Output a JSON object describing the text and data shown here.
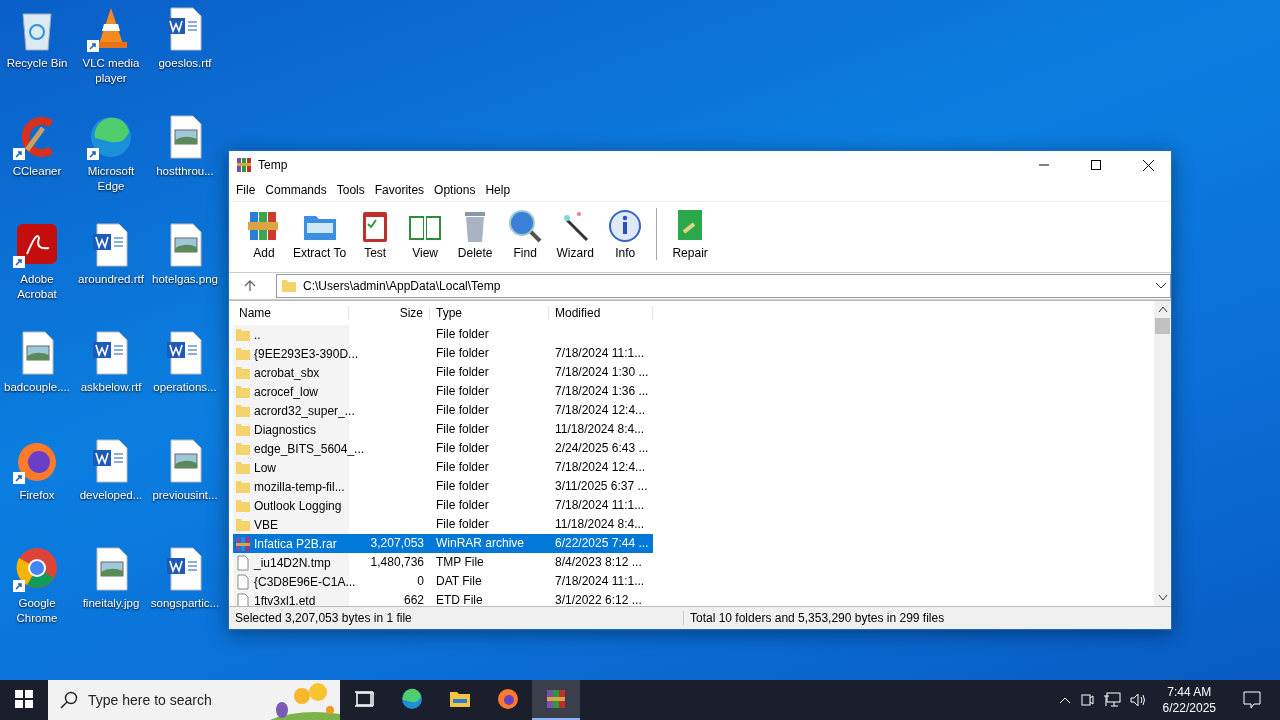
{
  "desktop_icons": [
    {
      "label": "Recycle Bin",
      "kind": "recycle",
      "shortcut": false
    },
    {
      "label": "VLC media player",
      "kind": "vlc",
      "shortcut": true
    },
    {
      "label": "goeslos.rtf",
      "kind": "word",
      "shortcut": false
    },
    {
      "label": "CCleaner",
      "kind": "ccleaner",
      "shortcut": true
    },
    {
      "label": "Microsoft Edge",
      "kind": "edge",
      "shortcut": true
    },
    {
      "label": "hostthrou...",
      "kind": "image",
      "shortcut": false
    },
    {
      "label": "Adobe Acrobat",
      "kind": "acrobat",
      "shortcut": true
    },
    {
      "label": "aroundred.rtf",
      "kind": "word",
      "shortcut": false
    },
    {
      "label": "hotelgas.png",
      "kind": "image",
      "shortcut": false
    },
    {
      "label": "badcouple....",
      "kind": "image",
      "shortcut": false
    },
    {
      "label": "askbelow.rtf",
      "kind": "word",
      "shortcut": false
    },
    {
      "label": "operations...",
      "kind": "word",
      "shortcut": false
    },
    {
      "label": "Firefox",
      "kind": "firefox",
      "shortcut": true
    },
    {
      "label": "developed...",
      "kind": "word",
      "shortcut": false
    },
    {
      "label": "previousint...",
      "kind": "image",
      "shortcut": false
    },
    {
      "label": "Google Chrome",
      "kind": "chrome",
      "shortcut": true
    },
    {
      "label": "fineitaly.jpg",
      "kind": "image",
      "shortcut": false
    },
    {
      "label": "songspartic...",
      "kind": "word",
      "shortcut": false
    }
  ],
  "window": {
    "title": "Temp",
    "menu": [
      "File",
      "Commands",
      "Tools",
      "Favorites",
      "Options",
      "Help"
    ],
    "toolbar": [
      {
        "label": "Add",
        "kind": "add"
      },
      {
        "label": "Extract To",
        "kind": "extract"
      },
      {
        "label": "Test",
        "kind": "test"
      },
      {
        "label": "View",
        "kind": "view"
      },
      {
        "label": "Delete",
        "kind": "delete"
      },
      {
        "label": "Find",
        "kind": "find"
      },
      {
        "label": "Wizard",
        "kind": "wizard"
      },
      {
        "label": "Info",
        "kind": "info"
      },
      {
        "label": "Repair",
        "kind": "repair"
      }
    ],
    "path": "C:\\Users\\admin\\AppData\\Local\\Temp",
    "columns": [
      "Name",
      "Size",
      "Type",
      "Modified"
    ],
    "rows": [
      {
        "name": "..",
        "size": "",
        "type": "File folder",
        "modified": "",
        "kind": "folder",
        "selected": false
      },
      {
        "name": "{9EE293E3-390D...",
        "size": "",
        "type": "File folder",
        "modified": "7/18/2024 11:1...",
        "kind": "folder",
        "selected": false
      },
      {
        "name": "acrobat_sbx",
        "size": "",
        "type": "File folder",
        "modified": "7/18/2024 1:30 ...",
        "kind": "folder",
        "selected": false
      },
      {
        "name": "acrocef_low",
        "size": "",
        "type": "File folder",
        "modified": "7/18/2024 1:36 ...",
        "kind": "folder",
        "selected": false
      },
      {
        "name": "acrord32_super_...",
        "size": "",
        "type": "File folder",
        "modified": "7/18/2024 12:4...",
        "kind": "folder",
        "selected": false
      },
      {
        "name": "Diagnostics",
        "size": "",
        "type": "File folder",
        "modified": "11/18/2024 8:4...",
        "kind": "folder",
        "selected": false
      },
      {
        "name": "edge_BITS_5604_...",
        "size": "",
        "type": "File folder",
        "modified": "2/24/2025 6:43 ...",
        "kind": "folder",
        "selected": false
      },
      {
        "name": "Low",
        "size": "",
        "type": "File folder",
        "modified": "7/18/2024 12:4...",
        "kind": "folder",
        "selected": false
      },
      {
        "name": "mozilla-temp-fil...",
        "size": "",
        "type": "File folder",
        "modified": "3/11/2025 6:37 ...",
        "kind": "folder",
        "selected": false
      },
      {
        "name": "Outlook Logging",
        "size": "",
        "type": "File folder",
        "modified": "7/18/2024 11:1...",
        "kind": "folder",
        "selected": false
      },
      {
        "name": "VBE",
        "size": "",
        "type": "File folder",
        "modified": "11/18/2024 8:4...",
        "kind": "folder",
        "selected": false
      },
      {
        "name": "Infatica P2B.rar",
        "size": "3,207,053",
        "type": "WinRAR archive",
        "modified": "6/22/2025 7:44 ...",
        "kind": "archive",
        "selected": true
      },
      {
        "name": "_iu14D2N.tmp",
        "size": "1,480,736",
        "type": "TMP File",
        "modified": "8/4/2023 8:12 ...",
        "kind": "file",
        "selected": false
      },
      {
        "name": "{C3D8E96E-C1A...",
        "size": "0",
        "type": "DAT File",
        "modified": "7/18/2024 11:1...",
        "kind": "file",
        "selected": false
      },
      {
        "name": "1ftv3xl1.etd",
        "size": "662",
        "type": "ETD File",
        "modified": "3/1/2022 6:12 ...",
        "kind": "file",
        "selected": false
      }
    ],
    "status_left": "Selected 3,207,053 bytes in 1 file",
    "status_right": "Total 10 folders and 5,353,290 bytes in 299 files"
  },
  "taskbar": {
    "search_placeholder": "Type here to search",
    "apps": [
      {
        "kind": "taskview",
        "selected": false
      },
      {
        "kind": "edge",
        "selected": false
      },
      {
        "kind": "explorer",
        "selected": false
      },
      {
        "kind": "firefox",
        "selected": false
      },
      {
        "kind": "winrar",
        "selected": true
      }
    ],
    "time": "7:44 AM",
    "date": "6/22/2025"
  }
}
